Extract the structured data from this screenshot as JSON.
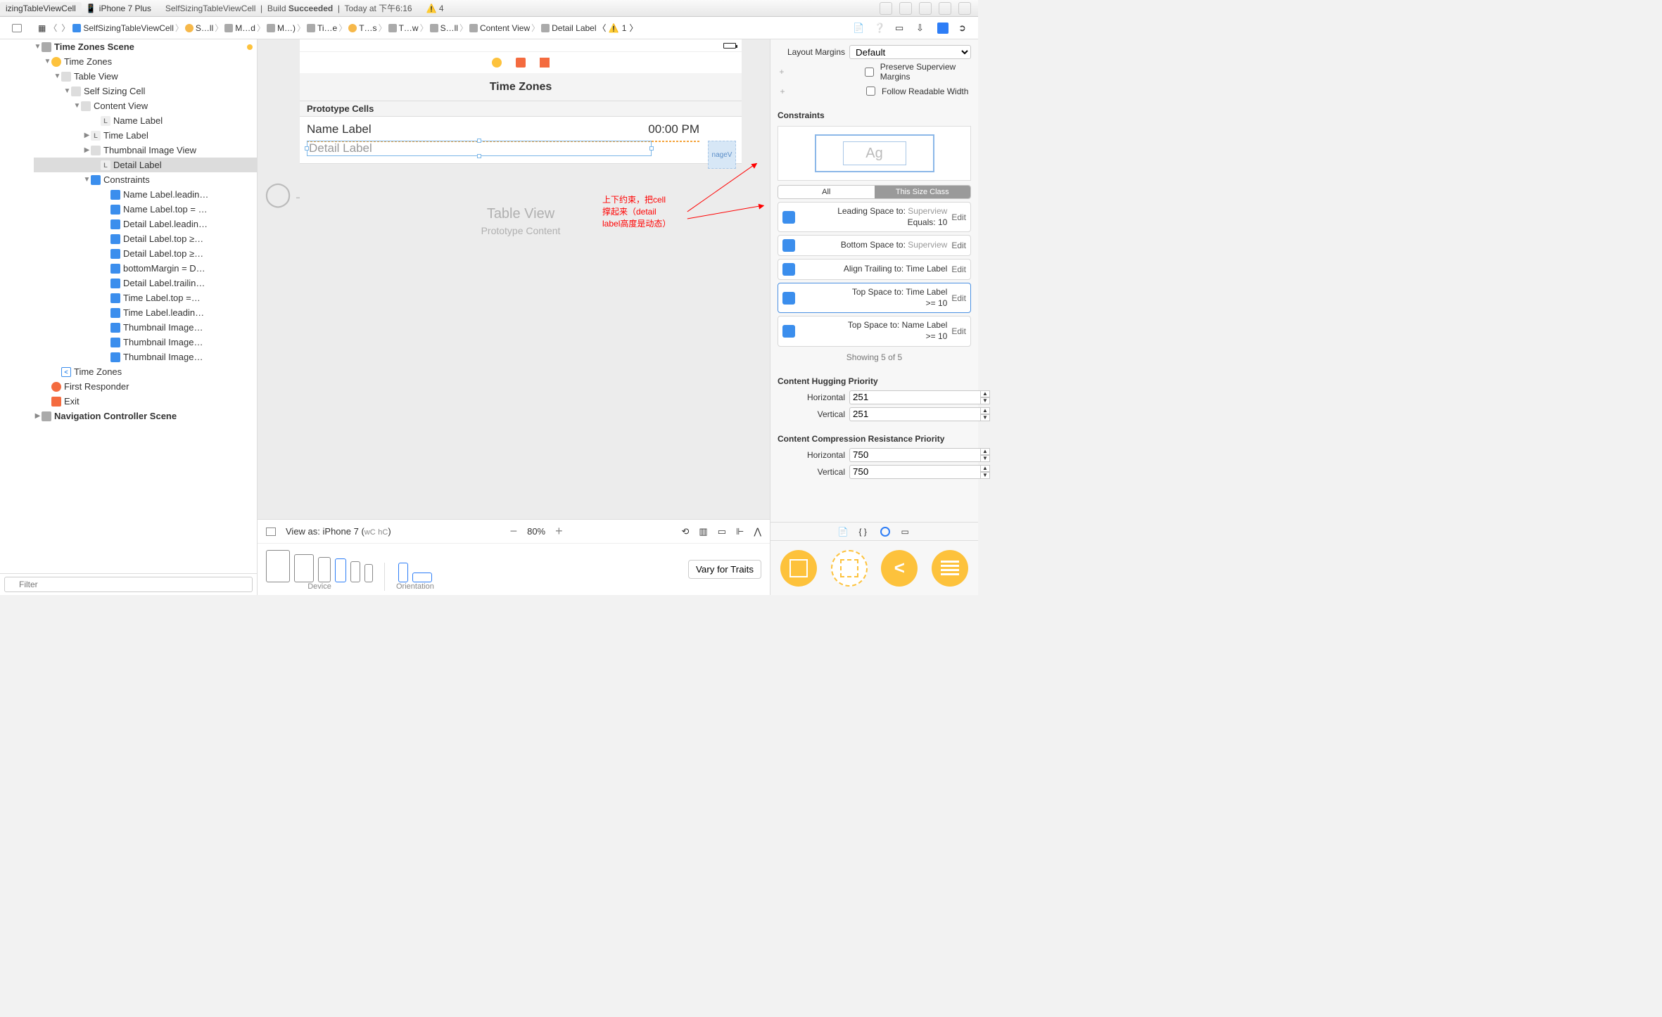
{
  "titlebar": {
    "tab": "izingTableViewCell",
    "device": "iPhone 7 Plus",
    "scheme": "SelfSizingTableViewCell",
    "build": "Build",
    "succeeded": "Succeeded",
    "today": "Today at 下午6:16",
    "warn_count": "4"
  },
  "jumpbar": {
    "items": [
      "SelfSizingTableViewCell",
      "S…ll",
      "M…d",
      "M…)",
      "Ti…e",
      "T…s",
      "T…w",
      "S…ll",
      "Content View",
      "Detail Label"
    ],
    "warn": "1"
  },
  "outline": {
    "scene_top": "Time Zones Scene",
    "vc": "Time Zones",
    "table": "Table View",
    "cell": "Self Sizing Cell",
    "content": "Content View",
    "labels": [
      "Name Label",
      "Time Label",
      "Thumbnail Image View",
      "Detail Label"
    ],
    "constraints_header": "Constraints",
    "constraints": [
      "Name Label.leadin…",
      "Name Label.top = …",
      "Detail Label.leadin…",
      "Detail Label.top ≥…",
      "Detail Label.top ≥…",
      "bottomMargin = D…",
      "Detail Label.trailin…",
      "Time Label.top =…",
      "Time Label.leadin…",
      "Thumbnail Image…",
      "Thumbnail Image…",
      "Thumbnail Image…"
    ],
    "back": "Time Zones",
    "first_responder": "First Responder",
    "exit": "Exit",
    "nav_scene": "Navigation Controller Scene",
    "filter_placeholder": "Filter"
  },
  "canvas": {
    "nav_title": "Time Zones",
    "proto": "Prototype Cells",
    "name_label": "Name Label",
    "time_label": "00:00 PM",
    "detail_label": "Detail Label",
    "imgthumb": "nageV",
    "table_view": "Table View",
    "proto_content": "Prototype Content",
    "annotation_l1": "上下约束，把cell",
    "annotation_l2": "撑起来（detail",
    "annotation_l3": "label高度是动态）",
    "view_as": "View as: iPhone 7 (",
    "view_as_wc": "wC",
    "view_as_hc": "hC",
    "view_as_close": ")",
    "zoom": "80%",
    "device_label": "Device",
    "orient_label": "Orientation",
    "vary": "Vary for Traits"
  },
  "inspector": {
    "layout_margins_label": "Layout Margins",
    "layout_margins_value": "Default",
    "preserve": "Preserve Superview Margins",
    "follow": "Follow Readable Width",
    "constraints_h": "Constraints",
    "ag": "Ag",
    "tab_all": "All",
    "tab_this": "This Size Class",
    "rows": [
      {
        "l1": "Leading Space to:",
        "t2": "Superview",
        "l2": "Equals:",
        "v": "10",
        "e": "Edit"
      },
      {
        "l1": "Bottom Space to:",
        "t2": "Superview",
        "l2": "",
        "v": "",
        "e": "Edit"
      },
      {
        "l1": "Align Trailing to:",
        "t2": "Time Label",
        "l2": "",
        "v": "",
        "e": "Edit"
      },
      {
        "l1": "Top Space to:",
        "t2": "Time Label",
        "l2": ">=",
        "v": "10",
        "e": "Edit"
      },
      {
        "l1": "Top Space to:",
        "t2": "Name Label",
        "l2": ">=",
        "v": "10",
        "e": "Edit"
      }
    ],
    "showing": "Showing 5 of 5",
    "chp": "Content Hugging Priority",
    "horiz": "Horizontal",
    "vert": "Vertical",
    "chp_h": "251",
    "chp_v": "251",
    "ccrp": "Content Compression Resistance Priority",
    "ccrp_h": "750",
    "ccrp_v": "750"
  }
}
